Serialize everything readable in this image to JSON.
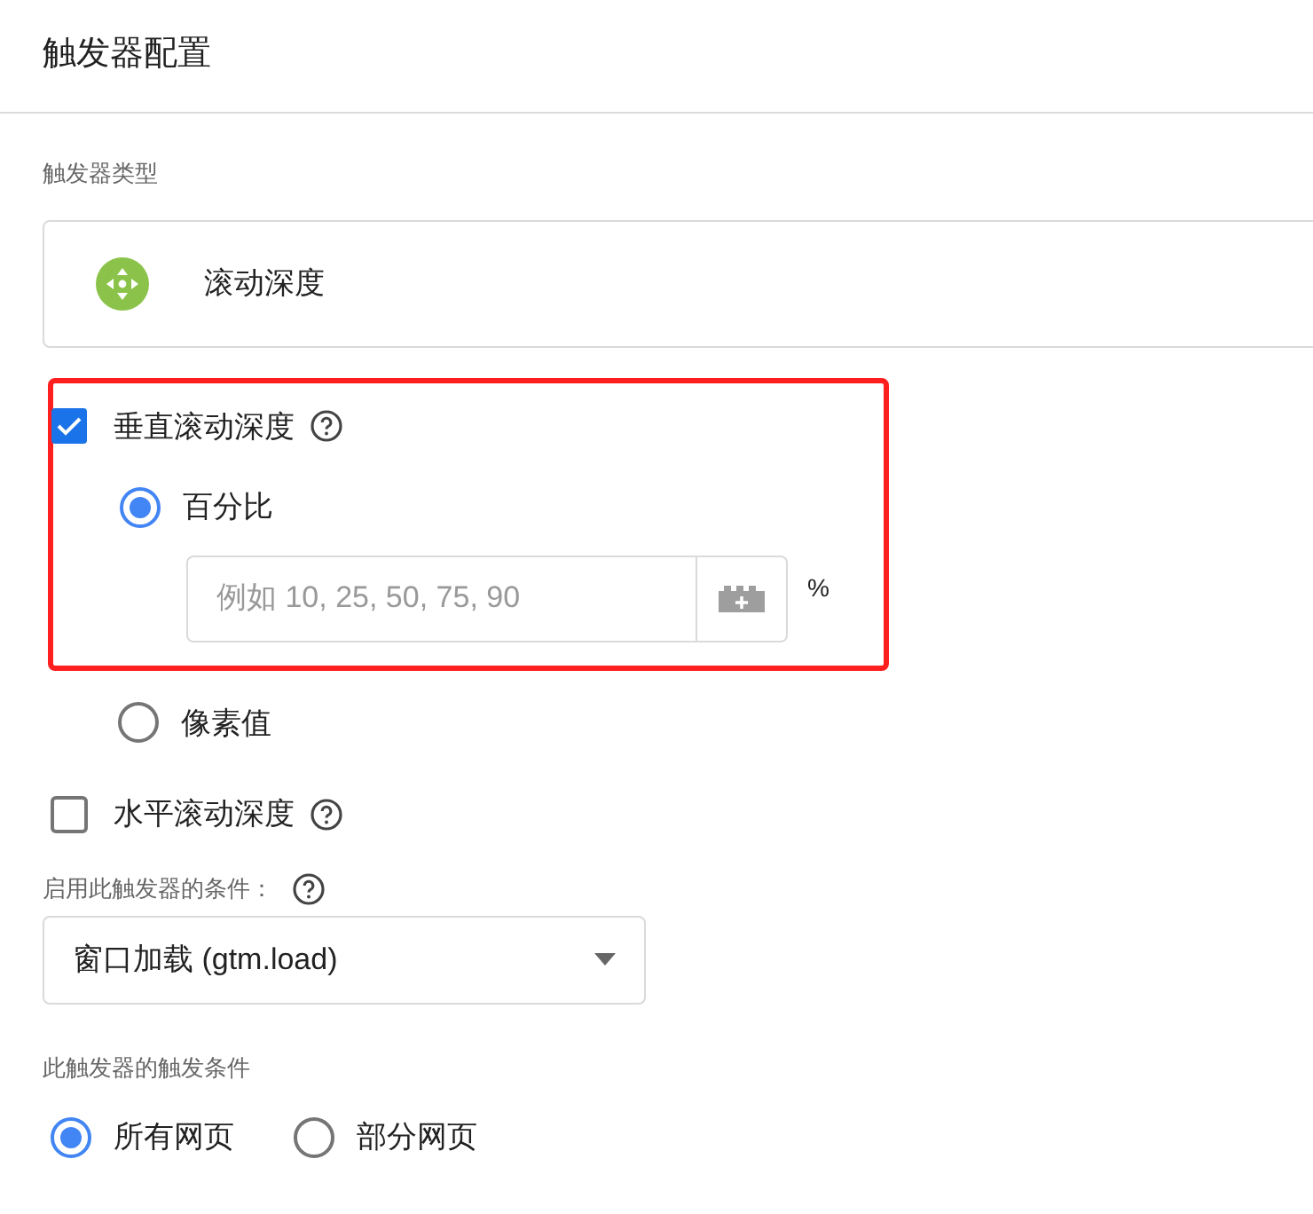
{
  "title": "触发器配置",
  "trigger_type": {
    "label": "触发器类型",
    "value": "滚动深度"
  },
  "vertical": {
    "label": "垂直滚动深度",
    "checked": true,
    "highlighted": true,
    "options": [
      {
        "label": "百分比",
        "selected": true
      },
      {
        "label": "像素值",
        "selected": false
      }
    ],
    "input": {
      "placeholder": "例如 10, 25, 50, 75, 90",
      "unit": "%"
    }
  },
  "horizontal": {
    "label": "水平滚动深度",
    "checked": false
  },
  "enable_condition": {
    "label": "启用此触发器的条件：",
    "value": "窗口加载 (gtm.load)"
  },
  "fire_on": {
    "label": "此触发器的触发条件",
    "options": [
      {
        "label": "所有网页",
        "selected": true
      },
      {
        "label": "部分网页",
        "selected": false
      }
    ]
  }
}
